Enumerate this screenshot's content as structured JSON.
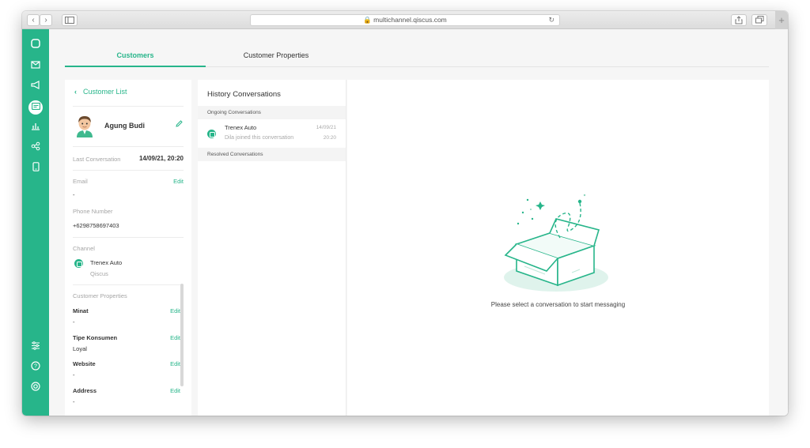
{
  "browser": {
    "url": "multichannel.qiscus.com",
    "lock_icon": "lock-icon",
    "back_icon": "chevron-left-icon",
    "forward_icon": "chevron-right-icon",
    "sidebar_icon": "sidebar-toggle-icon",
    "reload_icon": "reload-icon",
    "share_icon": "share-icon",
    "tabs_icon": "tabs-icon",
    "new_tab_icon": "plus-icon"
  },
  "sidebar": {
    "accent": "#27b58a",
    "icons": [
      "chat-icon",
      "mail-icon",
      "megaphone-icon",
      "customer-card-icon",
      "analytics-icon",
      "integration-icon",
      "mobile-icon",
      "settings-sliders-icon",
      "help-icon",
      "profile-icon"
    ]
  },
  "tabs": [
    {
      "label": "Customers",
      "active": true
    },
    {
      "label": "Customer Properties",
      "active": false
    }
  ],
  "customer": {
    "back_label": "Customer List",
    "name": "Agung Budi",
    "last_conversation_label": "Last Conversation",
    "last_conversation_value": "14/09/21, 20:20",
    "email_label": "Email",
    "email_edit": "Edit",
    "email_value": "-",
    "phone_label": "Phone Number",
    "phone_value": "+6298758697403",
    "channel_label": "Channel",
    "channel_name": "Trenex Auto",
    "channel_source": "Qiscus",
    "properties_label": "Customer Properties",
    "properties": [
      {
        "name": "Minat",
        "value": "-",
        "edit": "Edit"
      },
      {
        "name": "Tipe Konsumen",
        "value": "Loyal",
        "edit": "Edit"
      },
      {
        "name": "Website",
        "value": "-",
        "edit": "Edit"
      },
      {
        "name": "Address",
        "value": "-",
        "edit": "Edit"
      }
    ]
  },
  "history": {
    "title": "History Conversations",
    "ongoing_label": "Ongoing Conversations",
    "resolved_label": "Resolved Conversations",
    "conversations": [
      {
        "name": "Trenex Auto",
        "message": "Dila joined this conversation",
        "date": "14/09/21",
        "time": "20:20"
      }
    ]
  },
  "empty_state": {
    "message": "Please select a conversation to start messaging",
    "illustration": "open-box-illustration"
  }
}
